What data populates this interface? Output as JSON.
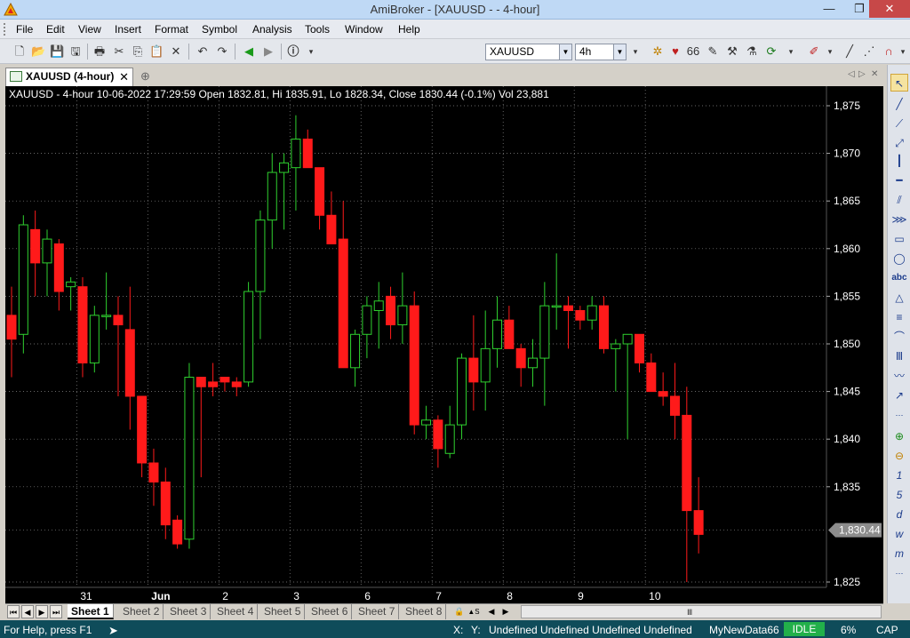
{
  "window": {
    "title": "AmiBroker - [XAUUSD -  - 4-hour]",
    "minimize": "—",
    "restore": "❐",
    "close": "✕"
  },
  "menu": [
    "File",
    "Edit",
    "View",
    "Insert",
    "Format",
    "Symbol",
    "Analysis",
    "Tools",
    "Window",
    "Help"
  ],
  "toolbar": {
    "symbol_value": "XAUUSD",
    "interval_value": "4h"
  },
  "tab": {
    "label": "XAUUSD (4-hour)",
    "close": "✕",
    "new": "⊕"
  },
  "chart_header": "XAUUSD - 4-hour 10-06-2022 17:29:59 Open 1832.81, Hi 1835.91, Lo 1828.34, Close 1830.44 (-0.1%) Vol 23,881",
  "colors": {
    "up": "#2fd12f",
    "down": "#ff1a1a",
    "grid": "#8a8a8a",
    "price_tag_bg": "#8c8c8c"
  },
  "chart_data": {
    "type": "candlestick",
    "yticks": [
      "1,875",
      "1,870",
      "1,865",
      "1,860",
      "1,855",
      "1,850",
      "1,845",
      "1,840",
      "1,835",
      "1,830.44",
      "1,825"
    ],
    "ylim": [
      1823,
      1879
    ],
    "last_price": "1,830.44",
    "xticks": [
      {
        "label": "31",
        "index": 6
      },
      {
        "label": "Jun",
        "index": 12
      },
      {
        "label": "2",
        "index": 18
      },
      {
        "label": "3",
        "index": 24
      },
      {
        "label": "6",
        "index": 30
      },
      {
        "label": "7",
        "index": 36
      },
      {
        "label": "8",
        "index": 42
      },
      {
        "label": "9",
        "index": 48
      },
      {
        "label": "10",
        "index": 54
      }
    ],
    "candles": [
      {
        "o": 1853.0,
        "h": 1856.0,
        "l": 1846.5,
        "c": 1850.5
      },
      {
        "o": 1851.0,
        "h": 1863.5,
        "l": 1849.0,
        "c": 1862.5
      },
      {
        "o": 1862.0,
        "h": 1864.0,
        "l": 1855.0,
        "c": 1858.5
      },
      {
        "o": 1858.5,
        "h": 1862.0,
        "l": 1855.0,
        "c": 1861.0
      },
      {
        "o": 1860.5,
        "h": 1861.0,
        "l": 1853.5,
        "c": 1855.5
      },
      {
        "o": 1856.0,
        "h": 1857.0,
        "l": 1853.5,
        "c": 1856.5
      },
      {
        "o": 1856.0,
        "h": 1857.0,
        "l": 1846.5,
        "c": 1848.0
      },
      {
        "o": 1848.0,
        "h": 1854.0,
        "l": 1847.0,
        "c": 1853.0
      },
      {
        "o": 1853.0,
        "h": 1857.5,
        "l": 1851.5,
        "c": 1853.0
      },
      {
        "o": 1853.0,
        "h": 1855.0,
        "l": 1844.5,
        "c": 1852.0
      },
      {
        "o": 1851.5,
        "h": 1856.0,
        "l": 1841.0,
        "c": 1844.5
      },
      {
        "o": 1844.5,
        "h": 1844.5,
        "l": 1836.0,
        "c": 1837.5
      },
      {
        "o": 1837.5,
        "h": 1839.0,
        "l": 1833.0,
        "c": 1835.5
      },
      {
        "o": 1835.5,
        "h": 1837.0,
        "l": 1829.5,
        "c": 1831.0
      },
      {
        "o": 1831.5,
        "h": 1832.0,
        "l": 1828.5,
        "c": 1829.0
      },
      {
        "o": 1829.5,
        "h": 1848.0,
        "l": 1828.5,
        "c": 1846.5
      },
      {
        "o": 1846.5,
        "h": 1846.5,
        "l": 1836.0,
        "c": 1845.5
      },
      {
        "o": 1846.0,
        "h": 1848.0,
        "l": 1844.5,
        "c": 1845.5
      },
      {
        "o": 1846.5,
        "h": 1846.5,
        "l": 1845.0,
        "c": 1846.0
      },
      {
        "o": 1846.0,
        "h": 1846.5,
        "l": 1844.5,
        "c": 1845.5
      },
      {
        "o": 1846.0,
        "h": 1856.5,
        "l": 1845.5,
        "c": 1855.5
      },
      {
        "o": 1855.5,
        "h": 1864.0,
        "l": 1850.5,
        "c": 1863.0
      },
      {
        "o": 1863.0,
        "h": 1870.0,
        "l": 1860.0,
        "c": 1868.0
      },
      {
        "o": 1868.0,
        "h": 1870.0,
        "l": 1862.0,
        "c": 1869.0
      },
      {
        "o": 1868.5,
        "h": 1874.0,
        "l": 1864.0,
        "c": 1871.5
      },
      {
        "o": 1871.5,
        "h": 1872.5,
        "l": 1869.0,
        "c": 1868.5
      },
      {
        "o": 1868.5,
        "h": 1868.5,
        "l": 1862.0,
        "c": 1863.5
      },
      {
        "o": 1863.5,
        "h": 1866.0,
        "l": 1860.5,
        "c": 1860.5
      },
      {
        "o": 1861.0,
        "h": 1865.0,
        "l": 1847.5,
        "c": 1847.5
      },
      {
        "o": 1847.5,
        "h": 1851.5,
        "l": 1845.5,
        "c": 1851.0
      },
      {
        "o": 1851.0,
        "h": 1855.0,
        "l": 1848.5,
        "c": 1854.0
      },
      {
        "o": 1853.5,
        "h": 1856.5,
        "l": 1849.5,
        "c": 1854.5
      },
      {
        "o": 1855.0,
        "h": 1856.0,
        "l": 1850.5,
        "c": 1852.0
      },
      {
        "o": 1852.0,
        "h": 1857.5,
        "l": 1850.0,
        "c": 1854.0
      },
      {
        "o": 1854.0,
        "h": 1855.5,
        "l": 1840.5,
        "c": 1841.5
      },
      {
        "o": 1841.5,
        "h": 1843.5,
        "l": 1840.0,
        "c": 1842.0
      },
      {
        "o": 1842.0,
        "h": 1842.5,
        "l": 1837.0,
        "c": 1839.0
      },
      {
        "o": 1838.5,
        "h": 1843.5,
        "l": 1838.0,
        "c": 1841.5
      },
      {
        "o": 1841.5,
        "h": 1849.0,
        "l": 1840.0,
        "c": 1848.5
      },
      {
        "o": 1848.5,
        "h": 1853.0,
        "l": 1843.0,
        "c": 1846.0
      },
      {
        "o": 1846.0,
        "h": 1853.5,
        "l": 1843.0,
        "c": 1849.5
      },
      {
        "o": 1849.5,
        "h": 1855.0,
        "l": 1847.5,
        "c": 1852.5
      },
      {
        "o": 1852.5,
        "h": 1854.0,
        "l": 1849.5,
        "c": 1849.5
      },
      {
        "o": 1849.5,
        "h": 1850.0,
        "l": 1845.5,
        "c": 1847.5
      },
      {
        "o": 1847.5,
        "h": 1850.5,
        "l": 1845.5,
        "c": 1848.5
      },
      {
        "o": 1848.5,
        "h": 1856.5,
        "l": 1843.5,
        "c": 1854.0
      },
      {
        "o": 1854.0,
        "h": 1859.5,
        "l": 1851.5,
        "c": 1854.0
      },
      {
        "o": 1854.0,
        "h": 1855.0,
        "l": 1849.5,
        "c": 1853.5
      },
      {
        "o": 1853.5,
        "h": 1854.0,
        "l": 1851.5,
        "c": 1852.5
      },
      {
        "o": 1852.5,
        "h": 1855.0,
        "l": 1851.5,
        "c": 1854.0
      },
      {
        "o": 1854.0,
        "h": 1855.0,
        "l": 1849.0,
        "c": 1849.5
      },
      {
        "o": 1849.5,
        "h": 1850.5,
        "l": 1845.0,
        "c": 1850.0
      },
      {
        "o": 1850.0,
        "h": 1851.0,
        "l": 1840.0,
        "c": 1851.0
      },
      {
        "o": 1851.0,
        "h": 1851.0,
        "l": 1847.0,
        "c": 1848.0
      },
      {
        "o": 1848.0,
        "h": 1849.0,
        "l": 1845.0,
        "c": 1845.0
      },
      {
        "o": 1845.0,
        "h": 1847.0,
        "l": 1843.5,
        "c": 1844.5
      },
      {
        "o": 1844.5,
        "h": 1848.0,
        "l": 1840.0,
        "c": 1842.5
      },
      {
        "o": 1842.5,
        "h": 1845.5,
        "l": 1825.0,
        "c": 1832.5
      },
      {
        "o": 1832.5,
        "h": 1836.0,
        "l": 1828.0,
        "c": 1830.0
      }
    ]
  },
  "sheets": {
    "active": "Sheet 1",
    "others": [
      "Sheet 2",
      "Sheet 3",
      "Sheet 4",
      "Sheet 5",
      "Sheet 6",
      "Sheet 7",
      "Sheet 8"
    ]
  },
  "status": {
    "help": "For Help, press F1",
    "x": "X:",
    "y": "Y:",
    "fields": "Undefined  Undefined  Undefined  Undefined",
    "database": "MyNewData66",
    "state": "IDLE",
    "cpu": "6%",
    "caps": "CAP"
  }
}
